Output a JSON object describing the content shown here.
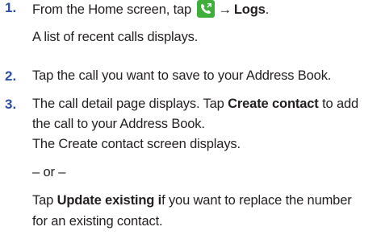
{
  "steps": [
    {
      "number": "1.",
      "text_before_icon": "From the Home screen, tap ",
      "icon": "phone-icon",
      "arrow": "→",
      "bold_after": "Logs",
      "trailing": ".",
      "result": "A list of recent calls displays."
    },
    {
      "number": "2.",
      "text": "Tap the call you want to save to your Address Book."
    },
    {
      "number": "3.",
      "line1_a": "The call detail page displays. Tap ",
      "line1_bold": "Create contact",
      "line1_b": " to add",
      "line2": "the call to your Address Book.",
      "result": "The Create contact screen displays.",
      "or": "– or –",
      "alt_line1_a": "Tap ",
      "alt_line1_bold": "Update existing i",
      "alt_line1_b": "f you want to replace the number",
      "alt_line2": "for an existing contact."
    }
  ],
  "colors": {
    "step_number": "#2d4fa1",
    "icon_background": "#3fae3a",
    "body_text": "#231f20"
  }
}
